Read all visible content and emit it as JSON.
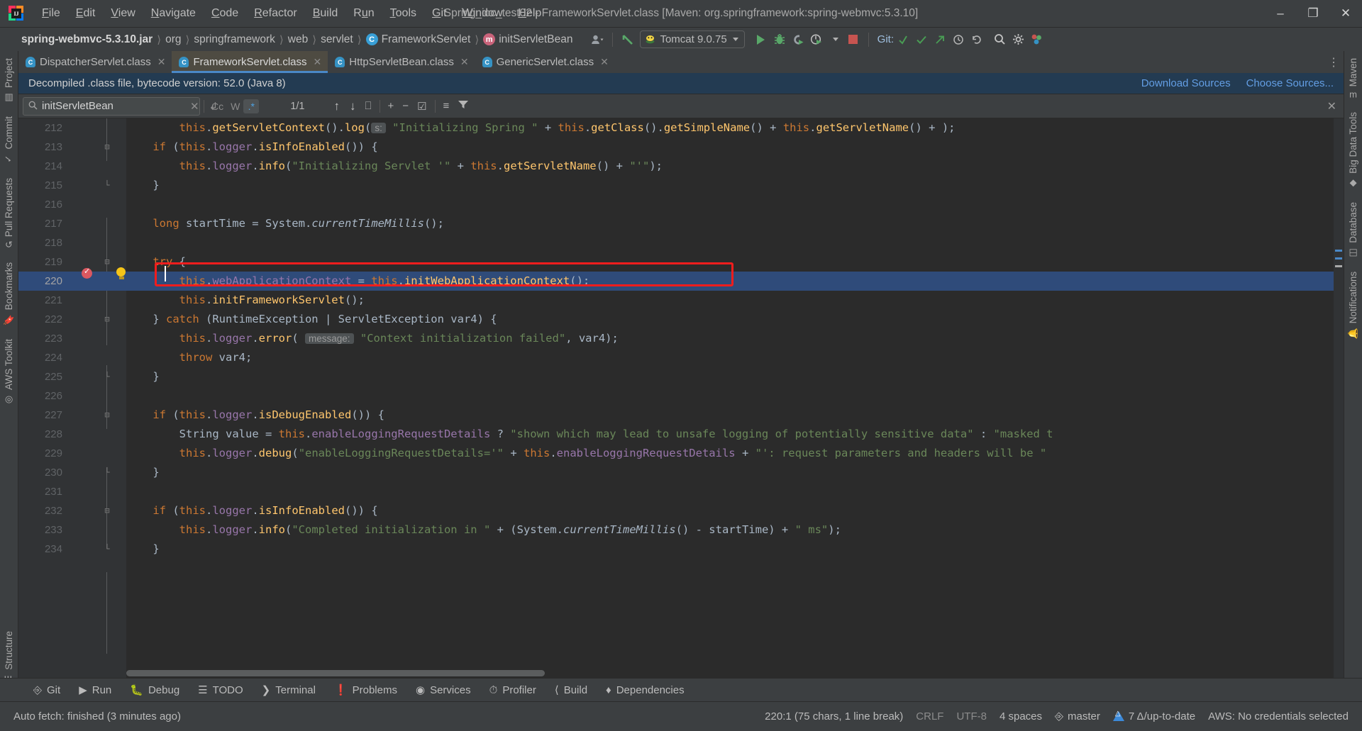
{
  "window": {
    "title": "Spring_ioc_test02 - FrameworkServlet.class [Maven: org.springframework:spring-webmvc:5.3.10]",
    "minimize": "–",
    "maximize": "❐",
    "close": "✕"
  },
  "menubar": [
    {
      "label": "File",
      "mnemonic": "F"
    },
    {
      "label": "Edit",
      "mnemonic": "E"
    },
    {
      "label": "View",
      "mnemonic": "V"
    },
    {
      "label": "Navigate",
      "mnemonic": "N"
    },
    {
      "label": "Code",
      "mnemonic": "C"
    },
    {
      "label": "Refactor",
      "mnemonic": "R"
    },
    {
      "label": "Build",
      "mnemonic": "B"
    },
    {
      "label": "Run",
      "mnemonic": "u"
    },
    {
      "label": "Tools",
      "mnemonic": "T"
    },
    {
      "label": "Git",
      "mnemonic": "G"
    },
    {
      "label": "Window",
      "mnemonic": "W"
    },
    {
      "label": "Help",
      "mnemonic": "H"
    }
  ],
  "breadcrumbs": [
    {
      "label": "spring-webmvc-5.3.10.jar",
      "icon": "",
      "strong": true
    },
    {
      "label": "org",
      "icon": ""
    },
    {
      "label": "springframework",
      "icon": ""
    },
    {
      "label": "web",
      "icon": ""
    },
    {
      "label": "servlet",
      "icon": ""
    },
    {
      "label": "FrameworkServlet",
      "icon": "C"
    },
    {
      "label": "initServletBean",
      "icon": "m"
    }
  ],
  "toolbar": {
    "run_config": "Tomcat 9.0.75",
    "git_label": "Git:",
    "icons": [
      "user-avatar-icon",
      "build-hammer-icon",
      "run-icon",
      "debug-icon",
      "run-with-coverage-icon",
      "profiler-icon",
      "stop-icon",
      "git-update-icon",
      "git-commit-icon",
      "git-push-icon",
      "git-history-icon",
      "git-rollback-icon",
      "search-everywhere-icon",
      "settings-gear-icon",
      "plugin-icon"
    ]
  },
  "left_tools": [
    {
      "label": "Project",
      "icon": "project-icon"
    },
    {
      "label": "Commit",
      "icon": "commit-icon"
    },
    {
      "label": "Pull Requests",
      "icon": "pull-request-icon"
    },
    {
      "label": "Bookmarks",
      "icon": "bookmark-icon"
    },
    {
      "label": "AWS Toolkit",
      "icon": "aws-icon"
    },
    {
      "label": "Structure",
      "icon": "structure-icon"
    }
  ],
  "right_tools": [
    {
      "label": "Maven",
      "icon": "maven-icon"
    },
    {
      "label": "Big Data Tools",
      "icon": "bigdata-icon"
    },
    {
      "label": "Database",
      "icon": "database-icon"
    },
    {
      "label": "Notifications",
      "icon": "notification-bell-icon"
    }
  ],
  "tabs": [
    {
      "label": "DispatcherServlet.class",
      "icon": "C",
      "active": false
    },
    {
      "label": "FrameworkServlet.class",
      "icon": "C",
      "active": true
    },
    {
      "label": "HttpServletBean.class",
      "icon": "C",
      "active": false
    },
    {
      "label": "GenericServlet.class",
      "icon": "C",
      "active": false
    }
  ],
  "banner": {
    "text": "Decompiled .class file, bytecode version: 52.0 (Java 8)",
    "download_sources": "Download Sources",
    "choose_sources": "Choose Sources..."
  },
  "findbar": {
    "query": "initServletBean",
    "placeholder": "Search",
    "match_count": "1/1",
    "case_sensitive": "Cc",
    "words": "W",
    "regex": ".*",
    "clear": "✕",
    "new_line": "↲",
    "prev": "↑",
    "next": "↓",
    "select_all": "⎕",
    "add_line": "+",
    "remove_line": "−",
    "select_occurrences": "☑",
    "filter": "filter-icon",
    "close": "✕"
  },
  "editor": {
    "first_line": 212,
    "lines": [
      {
        "n": 212,
        "fold": "",
        "tokens": [
          {
            "t": "        ",
            "c": "pln"
          },
          {
            "t": "this",
            "c": "kw"
          },
          {
            "t": ".",
            "c": "pln"
          },
          {
            "t": "getServletContext",
            "c": "mth"
          },
          {
            "t": "().",
            "c": "pln"
          },
          {
            "t": "log",
            "c": "mth"
          },
          {
            "t": "(",
            "c": "pln"
          },
          {
            "t": "s:",
            "c": "hint"
          },
          {
            "t": " ",
            "c": "pln"
          },
          {
            "t": "\"Initializing Spring \"",
            "c": "str"
          },
          {
            "t": " + ",
            "c": "pln"
          },
          {
            "t": "this",
            "c": "kw"
          },
          {
            "t": ".",
            "c": "pln"
          },
          {
            "t": "getClass",
            "c": "mth"
          },
          {
            "t": "().",
            "c": "pln"
          },
          {
            "t": "getSimpleName",
            "c": "mth"
          },
          {
            "t": "() + ",
            "c": "pln"
          },
          {
            "t": "this",
            "c": "kw"
          },
          {
            "t": ".",
            "c": "pln"
          },
          {
            "t": "getServletName",
            "c": "mth"
          },
          {
            "t": "() + ",
            "c": "pln"
          },
          {
            "t": ");",
            "c": "pln"
          }
        ]
      },
      {
        "n": 213,
        "fold": "minus",
        "tokens": [
          {
            "t": "    ",
            "c": "pln"
          },
          {
            "t": "if",
            "c": "kw"
          },
          {
            "t": " (",
            "c": "pln"
          },
          {
            "t": "this",
            "c": "kw"
          },
          {
            "t": ".",
            "c": "pln"
          },
          {
            "t": "logger",
            "c": "fld"
          },
          {
            "t": ".",
            "c": "pln"
          },
          {
            "t": "isInfoEnabled",
            "c": "mth"
          },
          {
            "t": "()) {",
            "c": "pln"
          }
        ]
      },
      {
        "n": 214,
        "fold": "",
        "tokens": [
          {
            "t": "        ",
            "c": "pln"
          },
          {
            "t": "this",
            "c": "kw"
          },
          {
            "t": ".",
            "c": "pln"
          },
          {
            "t": "logger",
            "c": "fld"
          },
          {
            "t": ".",
            "c": "pln"
          },
          {
            "t": "info",
            "c": "mth"
          },
          {
            "t": "(",
            "c": "pln"
          },
          {
            "t": "\"Initializing Servlet '\"",
            "c": "str"
          },
          {
            "t": " + ",
            "c": "pln"
          },
          {
            "t": "this",
            "c": "kw"
          },
          {
            "t": ".",
            "c": "pln"
          },
          {
            "t": "getServletName",
            "c": "mth"
          },
          {
            "t": "() + ",
            "c": "pln"
          },
          {
            "t": "\"'\"",
            "c": "str"
          },
          {
            "t": ");",
            "c": "pln"
          }
        ]
      },
      {
        "n": 215,
        "fold": "end",
        "tokens": [
          {
            "t": "    }",
            "c": "pln"
          }
        ]
      },
      {
        "n": 216,
        "fold": "",
        "tokens": []
      },
      {
        "n": 217,
        "fold": "",
        "tokens": [
          {
            "t": "    ",
            "c": "pln"
          },
          {
            "t": "long",
            "c": "kw"
          },
          {
            "t": " startTime = ",
            "c": "pln"
          },
          {
            "t": "System",
            "c": "pln"
          },
          {
            "t": ".",
            "c": "pln"
          },
          {
            "t": "currentTimeMillis",
            "c": "stat"
          },
          {
            "t": "();",
            "c": "pln"
          }
        ]
      },
      {
        "n": 218,
        "fold": "",
        "tokens": []
      },
      {
        "n": 219,
        "fold": "minus",
        "tokens": [
          {
            "t": "    ",
            "c": "pln"
          },
          {
            "t": "try",
            "c": "kw"
          },
          {
            "t": " {",
            "c": "pln"
          }
        ]
      },
      {
        "n": 220,
        "fold": "",
        "highlight": true,
        "tokens": [
          {
            "t": "        ",
            "c": "pln"
          },
          {
            "t": "this",
            "c": "kw"
          },
          {
            "t": ".",
            "c": "pln"
          },
          {
            "t": "webApplicationContext",
            "c": "fld"
          },
          {
            "t": " = ",
            "c": "pln"
          },
          {
            "t": "this",
            "c": "kw"
          },
          {
            "t": ".",
            "c": "pln"
          },
          {
            "t": "initWebApplicationContext",
            "c": "mth"
          },
          {
            "t": "();",
            "c": "pln"
          }
        ]
      },
      {
        "n": 221,
        "fold": "",
        "tokens": [
          {
            "t": "        ",
            "c": "pln"
          },
          {
            "t": "this",
            "c": "kw"
          },
          {
            "t": ".",
            "c": "pln"
          },
          {
            "t": "initFrameworkServlet",
            "c": "mth"
          },
          {
            "t": "();",
            "c": "pln"
          }
        ]
      },
      {
        "n": 222,
        "fold": "minus",
        "tokens": [
          {
            "t": "    } ",
            "c": "pln"
          },
          {
            "t": "catch",
            "c": "kw"
          },
          {
            "t": " (RuntimeException | ServletException var4) {",
            "c": "pln"
          }
        ]
      },
      {
        "n": 223,
        "fold": "",
        "tokens": [
          {
            "t": "        ",
            "c": "pln"
          },
          {
            "t": "this",
            "c": "kw"
          },
          {
            "t": ".",
            "c": "pln"
          },
          {
            "t": "logger",
            "c": "fld"
          },
          {
            "t": ".",
            "c": "pln"
          },
          {
            "t": "error",
            "c": "mth"
          },
          {
            "t": "( ",
            "c": "pln"
          },
          {
            "t": "message:",
            "c": "hint"
          },
          {
            "t": " ",
            "c": "pln"
          },
          {
            "t": "\"Context initialization failed\"",
            "c": "str"
          },
          {
            "t": ", var4);",
            "c": "pln"
          }
        ]
      },
      {
        "n": 224,
        "fold": "",
        "tokens": [
          {
            "t": "        ",
            "c": "pln"
          },
          {
            "t": "throw",
            "c": "kw"
          },
          {
            "t": " var4;",
            "c": "pln"
          }
        ]
      },
      {
        "n": 225,
        "fold": "end",
        "tokens": [
          {
            "t": "    }",
            "c": "pln"
          }
        ]
      },
      {
        "n": 226,
        "fold": "",
        "tokens": []
      },
      {
        "n": 227,
        "fold": "minus",
        "tokens": [
          {
            "t": "    ",
            "c": "pln"
          },
          {
            "t": "if",
            "c": "kw"
          },
          {
            "t": " (",
            "c": "pln"
          },
          {
            "t": "this",
            "c": "kw"
          },
          {
            "t": ".",
            "c": "pln"
          },
          {
            "t": "logger",
            "c": "fld"
          },
          {
            "t": ".",
            "c": "pln"
          },
          {
            "t": "isDebugEnabled",
            "c": "mth"
          },
          {
            "t": "()) {",
            "c": "pln"
          }
        ]
      },
      {
        "n": 228,
        "fold": "",
        "tokens": [
          {
            "t": "        ",
            "c": "pln"
          },
          {
            "t": "String",
            "c": "pln"
          },
          {
            "t": " value = ",
            "c": "pln"
          },
          {
            "t": "this",
            "c": "kw"
          },
          {
            "t": ".",
            "c": "pln"
          },
          {
            "t": "enableLoggingRequestDetails",
            "c": "fld"
          },
          {
            "t": " ? ",
            "c": "pln"
          },
          {
            "t": "\"shown which may lead to unsafe logging of potentially sensitive data\"",
            "c": "str"
          },
          {
            "t": " : ",
            "c": "pln"
          },
          {
            "t": "\"masked t",
            "c": "str"
          }
        ]
      },
      {
        "n": 229,
        "fold": "",
        "tokens": [
          {
            "t": "        ",
            "c": "pln"
          },
          {
            "t": "this",
            "c": "kw"
          },
          {
            "t": ".",
            "c": "pln"
          },
          {
            "t": "logger",
            "c": "fld"
          },
          {
            "t": ".",
            "c": "pln"
          },
          {
            "t": "debug",
            "c": "mth"
          },
          {
            "t": "(",
            "c": "pln"
          },
          {
            "t": "\"enableLoggingRequestDetails='\"",
            "c": "str"
          },
          {
            "t": " + ",
            "c": "pln"
          },
          {
            "t": "this",
            "c": "kw"
          },
          {
            "t": ".",
            "c": "pln"
          },
          {
            "t": "enableLoggingRequestDetails",
            "c": "fld"
          },
          {
            "t": " + ",
            "c": "pln"
          },
          {
            "t": "\"': request parameters and headers will be \"",
            "c": "str"
          }
        ]
      },
      {
        "n": 230,
        "fold": "end",
        "tokens": [
          {
            "t": "    }",
            "c": "pln"
          }
        ]
      },
      {
        "n": 231,
        "fold": "",
        "tokens": []
      },
      {
        "n": 232,
        "fold": "minus",
        "tokens": [
          {
            "t": "    ",
            "c": "pln"
          },
          {
            "t": "if",
            "c": "kw"
          },
          {
            "t": " (",
            "c": "pln"
          },
          {
            "t": "this",
            "c": "kw"
          },
          {
            "t": ".",
            "c": "pln"
          },
          {
            "t": "logger",
            "c": "fld"
          },
          {
            "t": ".",
            "c": "pln"
          },
          {
            "t": "isInfoEnabled",
            "c": "mth"
          },
          {
            "t": "()) {",
            "c": "pln"
          }
        ]
      },
      {
        "n": 233,
        "fold": "",
        "tokens": [
          {
            "t": "        ",
            "c": "pln"
          },
          {
            "t": "this",
            "c": "kw"
          },
          {
            "t": ".",
            "c": "pln"
          },
          {
            "t": "logger",
            "c": "fld"
          },
          {
            "t": ".",
            "c": "pln"
          },
          {
            "t": "info",
            "c": "mth"
          },
          {
            "t": "(",
            "c": "pln"
          },
          {
            "t": "\"Completed initialization in \"",
            "c": "str"
          },
          {
            "t": " + (",
            "c": "pln"
          },
          {
            "t": "System",
            "c": "pln"
          },
          {
            "t": ".",
            "c": "pln"
          },
          {
            "t": "currentTimeMillis",
            "c": "stat"
          },
          {
            "t": "() - startTime) + ",
            "c": "pln"
          },
          {
            "t": "\" ms\"",
            "c": "str"
          },
          {
            "t": ");",
            "c": "pln"
          }
        ]
      },
      {
        "n": 234,
        "fold": "end",
        "tokens": [
          {
            "t": "    }",
            "c": "pln"
          }
        ]
      }
    ]
  },
  "bottom_windows": [
    {
      "label": "Git",
      "icon": "git-branch-icon"
    },
    {
      "label": "Run",
      "icon": "run-icon"
    },
    {
      "label": "Debug",
      "icon": "debug-icon"
    },
    {
      "label": "TODO",
      "icon": "todo-icon"
    },
    {
      "label": "Terminal",
      "icon": "terminal-icon"
    },
    {
      "label": "Problems",
      "icon": "problems-icon"
    },
    {
      "label": "Services",
      "icon": "services-icon"
    },
    {
      "label": "Profiler",
      "icon": "profiler-icon"
    },
    {
      "label": "Build",
      "icon": "build-icon"
    },
    {
      "label": "Dependencies",
      "icon": "dependencies-icon"
    }
  ],
  "statusbar": {
    "message": "Auto fetch: finished (3 minutes ago)",
    "caret_position": "220:1 (75 chars, 1 line break)",
    "line_separator": "CRLF",
    "encoding": "UTF-8",
    "indent": "4 spaces",
    "branch": "master",
    "vcs_status": "7 Δ/up-to-date",
    "aws": "AWS: No credentials selected"
  },
  "colors": {
    "accent_blue": "#4a88c7",
    "selection_blue": "#2f4b7a",
    "banner_blue": "#233b52",
    "annotation_red": "#f21d1d",
    "keyword_orange": "#cc7832",
    "field_purple": "#9876aa",
    "string_green": "#6a8759",
    "method_yellow": "#ffc66d",
    "plain_text": "#a9b7c6",
    "editor_bg": "#2b2b2b",
    "chrome_bg": "#3c3f41"
  }
}
